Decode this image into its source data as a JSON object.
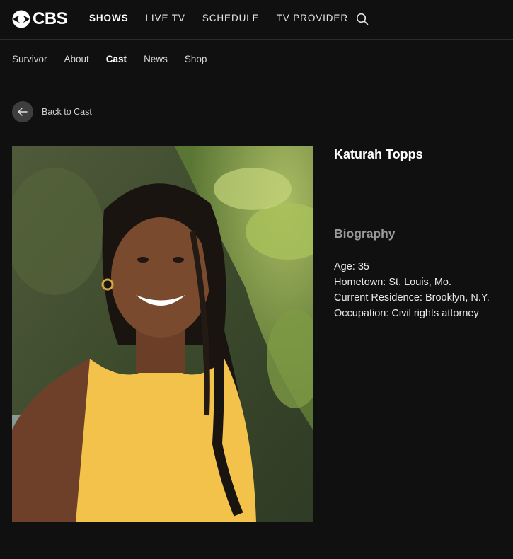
{
  "header": {
    "logo_text": "CBS",
    "nav": [
      {
        "label": "SHOWS",
        "active": true
      },
      {
        "label": "LIVE TV",
        "active": false
      },
      {
        "label": "SCHEDULE",
        "active": false
      },
      {
        "label": "TV PROVIDER",
        "active": false
      }
    ],
    "search_icon": "search-icon"
  },
  "subnav": [
    {
      "label": "Survivor",
      "active": false
    },
    {
      "label": "About",
      "active": false
    },
    {
      "label": "Cast",
      "active": true
    },
    {
      "label": "News",
      "active": false
    },
    {
      "label": "Shop",
      "active": false
    }
  ],
  "back": {
    "label": "Back to Cast",
    "icon": "arrow-left-icon"
  },
  "profile": {
    "name": "Katurah Topps",
    "bio_heading": "Biography",
    "bio_lines": [
      "Age: 35",
      "Hometown: St. Louis, Mo.",
      "Current Residence: Brooklyn, N.Y.",
      "Occupation: Civil rights attorney"
    ],
    "photo_alt": "cast-photo"
  },
  "colors": {
    "background": "#101010",
    "accent_shirt": "#f2c24b"
  }
}
